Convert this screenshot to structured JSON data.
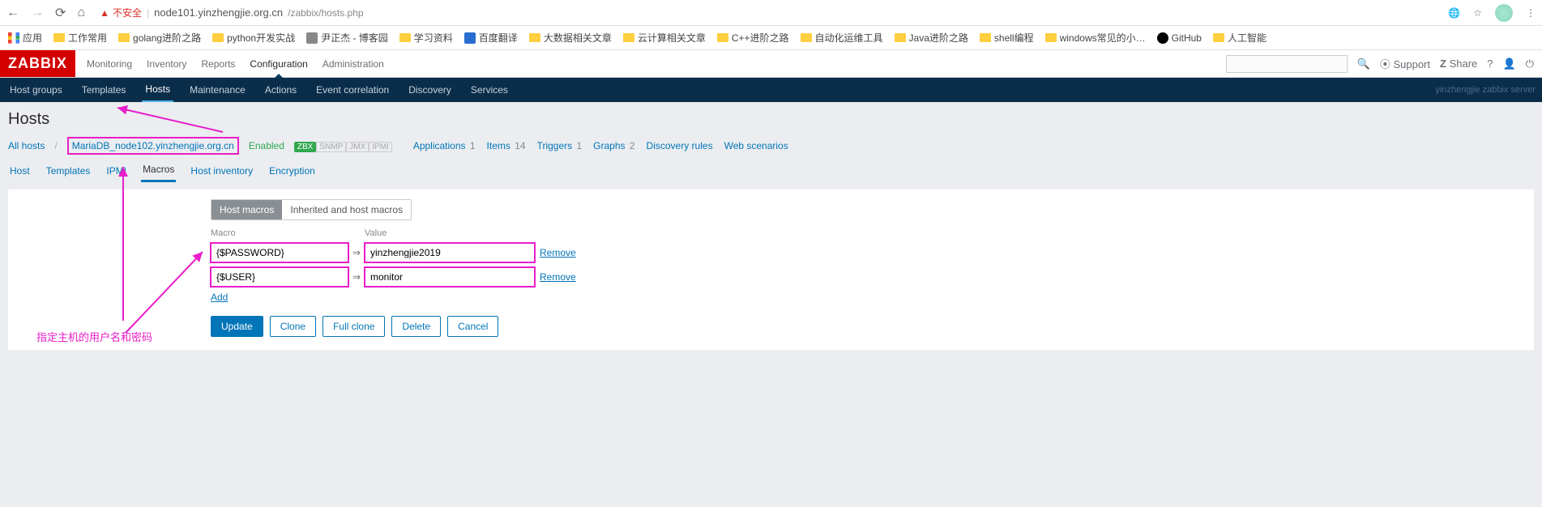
{
  "browser": {
    "security": "不安全",
    "url_host": "node101.yinzhengjie.org.cn",
    "url_path": "/zabbix/hosts.php"
  },
  "bookmarks": [
    {
      "icon": "apps",
      "label": "应用"
    },
    {
      "icon": "folder",
      "label": "工作常用"
    },
    {
      "icon": "folder",
      "label": "golang进阶之路"
    },
    {
      "icon": "folder",
      "label": "python开发实战"
    },
    {
      "icon": "generic",
      "label": "尹正杰 - 博客园"
    },
    {
      "icon": "folder",
      "label": "学习资料"
    },
    {
      "icon": "blue",
      "label": "百度翻译"
    },
    {
      "icon": "folder",
      "label": "大数据相关文章"
    },
    {
      "icon": "folder",
      "label": "云计算相关文章"
    },
    {
      "icon": "folder",
      "label": "C++进阶之路"
    },
    {
      "icon": "folder",
      "label": "自动化运维工具"
    },
    {
      "icon": "folder",
      "label": "Java进阶之路"
    },
    {
      "icon": "folder",
      "label": "shell编程"
    },
    {
      "icon": "folder",
      "label": "windows常见的小…"
    },
    {
      "icon": "github",
      "label": "GitHub"
    },
    {
      "icon": "folder",
      "label": "人工智能"
    }
  ],
  "zabbix": {
    "logo": "ZABBIX",
    "menu": [
      "Monitoring",
      "Inventory",
      "Reports",
      "Configuration",
      "Administration"
    ],
    "menu_active": "Configuration",
    "support": "Support",
    "share": "Share",
    "subnav": [
      "Host groups",
      "Templates",
      "Hosts",
      "Maintenance",
      "Actions",
      "Event correlation",
      "Discovery",
      "Services"
    ],
    "subnav_active": "Hosts",
    "server_label": "yinzhengjie zabbix server"
  },
  "page": {
    "title": "Hosts",
    "breadcrumb": {
      "all_hosts": "All hosts",
      "host_name": "MariaDB_node102.yinzhengjie.org.cn",
      "enabled": "Enabled",
      "protocols": [
        "ZBX",
        "SNMP",
        "JMX",
        "IPMI"
      ],
      "links": [
        {
          "label": "Applications",
          "count": "1"
        },
        {
          "label": "Items",
          "count": "14"
        },
        {
          "label": "Triggers",
          "count": "1"
        },
        {
          "label": "Graphs",
          "count": "2"
        },
        {
          "label": "Discovery rules",
          "count": ""
        },
        {
          "label": "Web scenarios",
          "count": ""
        }
      ]
    },
    "tabs": [
      "Host",
      "Templates",
      "IPMI",
      "Macros",
      "Host inventory",
      "Encryption"
    ],
    "tab_active": "Macros",
    "macros": {
      "toggle": {
        "active": "Host macros",
        "other": "Inherited and host macros"
      },
      "headers": {
        "macro": "Macro",
        "value": "Value"
      },
      "rows": [
        {
          "macro": "{$PASSWORD}",
          "value": "yinzhengjie2019",
          "remove": "Remove"
        },
        {
          "macro": "{$USER}",
          "value": "monitor",
          "remove": "Remove"
        }
      ],
      "add": "Add"
    },
    "actions": {
      "update": "Update",
      "clone": "Clone",
      "full_clone": "Full clone",
      "delete": "Delete",
      "cancel": "Cancel"
    },
    "annotation": "指定主机的用户名和密码"
  }
}
